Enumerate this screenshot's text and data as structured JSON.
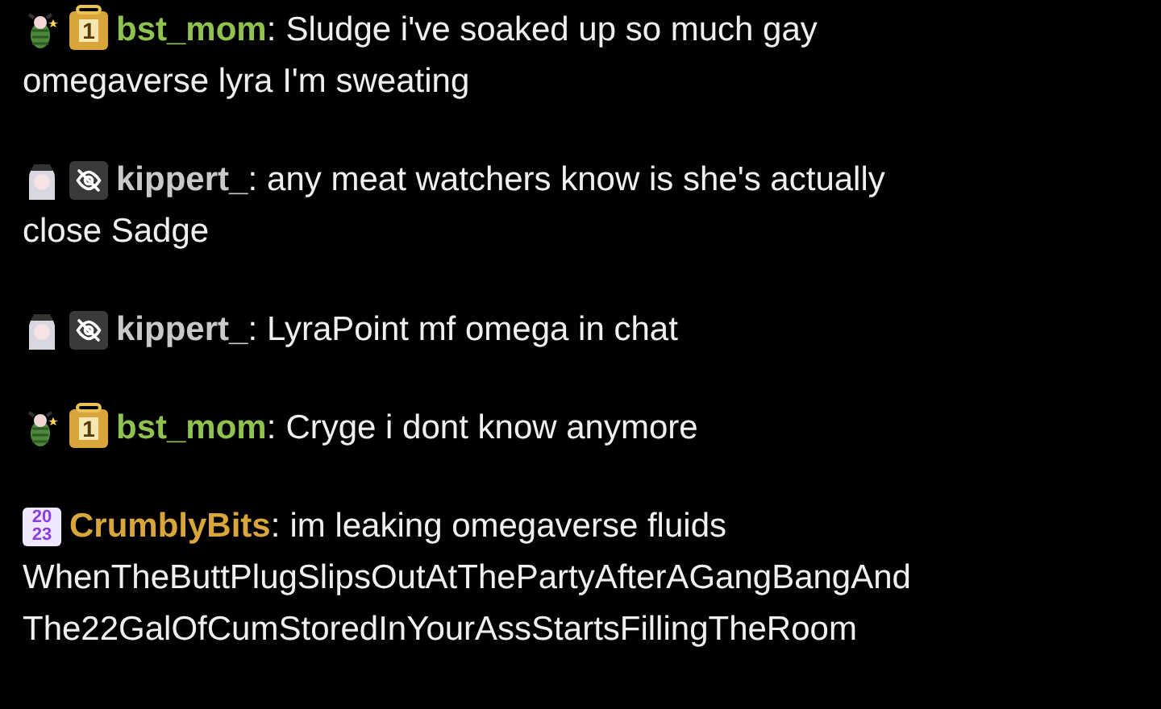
{
  "chat_messages": [
    {
      "badges": [
        {
          "kind": "bug"
        },
        {
          "kind": "gift",
          "label": "1"
        }
      ],
      "username": "bst_mom",
      "color": "#8fc24f",
      "colon": ":",
      "text": "Sludge i've soaked up so much gay",
      "continuation": [
        "omegaverse lyra I'm sweating"
      ]
    },
    {
      "badges": [
        {
          "kind": "girl"
        },
        {
          "kind": "hidden"
        }
      ],
      "username": "kippert_",
      "color": "#c9c9c9",
      "colon": ":",
      "text": "any meat watchers know is she's actually",
      "continuation": [
        "close Sadge"
      ]
    },
    {
      "badges": [
        {
          "kind": "girl"
        },
        {
          "kind": "hidden"
        }
      ],
      "username": "kippert_",
      "color": "#c9c9c9",
      "colon": ":",
      "text": "LyraPoint mf omega in chat"
    },
    {
      "badges": [
        {
          "kind": "bug"
        },
        {
          "kind": "gift",
          "label": "1"
        }
      ],
      "username": "bst_mom",
      "color": "#8fc24f",
      "colon": ":",
      "text": "Cryge i dont know anymore"
    },
    {
      "badges": [
        {
          "kind": "year",
          "label": "20",
          "label_2": "23"
        }
      ],
      "username": "CrumblyBits",
      "color": "#d9a63c",
      "colon": ":",
      "text": "im leaking omegaverse fluids",
      "continuation": [
        "WhenTheButtPlugSlipsOutAtThePartyAfterAGangBangAnd",
        "The22GalOfCumStoredInYourAssStartsFillingTheRoom"
      ]
    }
  ]
}
